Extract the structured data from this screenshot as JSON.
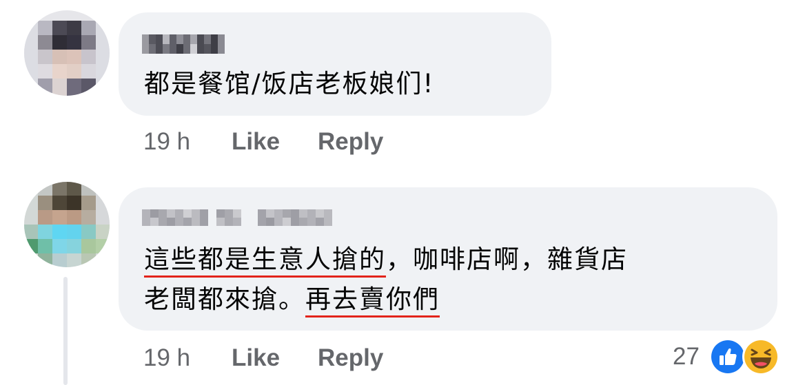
{
  "comments": [
    {
      "author_pixelated": true,
      "text_lines": [
        "都是餐馆/饭店老板娘们!"
      ],
      "time": "19 h",
      "like_label": "Like",
      "reply_label": "Reply"
    },
    {
      "author_pixelated": true,
      "text_lines": [
        {
          "marked": "這些都是生意人搶的",
          "rest": "，咖啡店啊，雜貨店"
        },
        {
          "rest": "老闆都來搶。",
          "marked": "再去賣你們"
        }
      ],
      "time": "19 h",
      "like_label": "Like",
      "reply_label": "Reply",
      "reaction_count": "27",
      "reactions": [
        "like-icon",
        "haha-icon"
      ]
    }
  ],
  "colors": {
    "bubble": "#f0f2f5",
    "text": "#050505",
    "meta": "#65676b",
    "underline": "#e2231a",
    "like_blue": "#1877f2",
    "haha_yellow": "#f7b928"
  }
}
